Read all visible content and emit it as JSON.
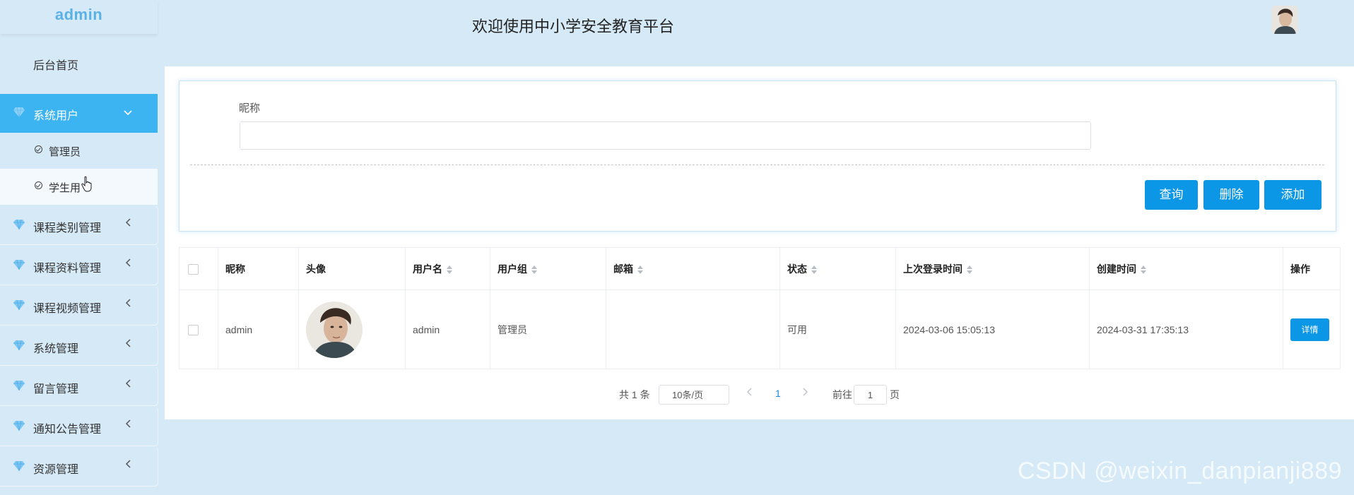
{
  "sidebar": {
    "brand": "admin",
    "home": "后台首页",
    "active_group": "系统用户",
    "sub_items": [
      "管理员",
      "学生用"
    ],
    "groups": [
      "课程类别管理",
      "课程资料管理",
      "课程视频管理",
      "系统管理",
      "留言管理",
      "通知公告管理",
      "资源管理"
    ]
  },
  "header": {
    "title": "欢迎使用中小学安全教育平台"
  },
  "search": {
    "label": "昵称",
    "value": "",
    "placeholder": "",
    "buttons": {
      "query": "查询",
      "delete": "删除",
      "add": "添加"
    }
  },
  "table": {
    "headers": [
      "昵称",
      "头像",
      "用户名",
      "用户组",
      "邮箱",
      "状态",
      "上次登录时间",
      "创建时间",
      "操作"
    ],
    "rows": [
      {
        "nickname": "admin",
        "username": "admin",
        "group": "管理员",
        "email": "",
        "status": "可用",
        "last_login": "2024-03-06 15:05:13",
        "created": "2024-03-31 17:35:13",
        "action": "详情"
      }
    ]
  },
  "pagination": {
    "total": "共 1 条",
    "page_size": "10条/页",
    "current": "1",
    "goto_label": "前往",
    "goto_value": "1",
    "unit": "页"
  },
  "watermark": "CSDN @weixin_danpianji889",
  "colors": {
    "accent": "#0b96e6",
    "sidebar_active": "#3db4f2",
    "background": "#d6e9f7"
  }
}
